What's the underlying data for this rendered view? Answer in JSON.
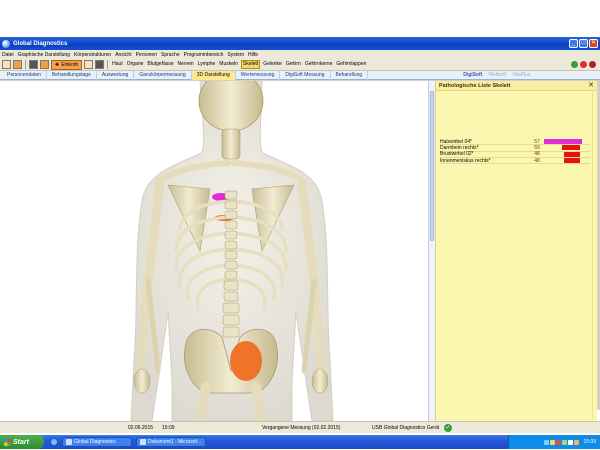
{
  "window": {
    "title": "Global Diagnostics",
    "btn_min": "_",
    "btn_max": "□",
    "btn_close": "✕"
  },
  "menu": [
    "Datei",
    "Graphische Darstellung",
    "Körperstrukturen",
    "Ansicht",
    "Personen",
    "Sprache",
    "Programmbereich",
    "System",
    "Hilfe"
  ],
  "toolbar": {
    "einkorb_label": "Einkorb",
    "categories": [
      "Haut",
      "Organe",
      "Blutgefässe",
      "Nerven",
      "Lymphe",
      "Muskeln",
      "Skelett",
      "Gelenke",
      "Gehirn",
      "Gehirnkerne",
      "Gehirnlappen"
    ],
    "active_category": "Skelett"
  },
  "tabs": [
    "Personendaten",
    "Behandlungstage",
    "Auswertung",
    "Ganzkörpermessung",
    "3D Darstellung",
    "Wertemessung",
    "DigiSoft Messung",
    "Behandlung"
  ],
  "active_tab": "3D Darstellung",
  "side_tabs": [
    "DigiSoft",
    "Wellsoft",
    "VitaPlus"
  ],
  "panel": {
    "title": "Pathologische Liste Skelett",
    "close": "✕",
    "rows": [
      {
        "name": "Halswirbel 04*",
        "value": "57",
        "fill": 0.95,
        "color": "#e22bd8"
      },
      {
        "name": "Darmbein rechts*",
        "value": "59",
        "fill": 0.45,
        "color": "#e81010"
      },
      {
        "name": "Brustwirbel 02*",
        "value": "48",
        "fill": 0.4,
        "color": "#e81010"
      },
      {
        "name": "Innenmeniskus rechts*",
        "value": "48",
        "fill": 0.4,
        "color": "#e81010"
      }
    ]
  },
  "status": {
    "date": "02.06.2015",
    "time": "15:09",
    "measurement": "Vergangene Messung (02.02.2015)",
    "device": "USB Global Diagnostics Gerät",
    "ok_glyph": "✓"
  },
  "taskbar": {
    "start_label": "Start",
    "buttons": [
      "Global Diagnostics",
      "Dokument1 - Microsof..."
    ],
    "clock": "15:09"
  },
  "colors": {
    "highlight_magenta": "#e22bd8",
    "highlight_red": "#e81010",
    "highlight_orange": "#f06a1e",
    "accent_blue": "#0a3fc2",
    "panel_yellow": "#fbf7b0"
  }
}
